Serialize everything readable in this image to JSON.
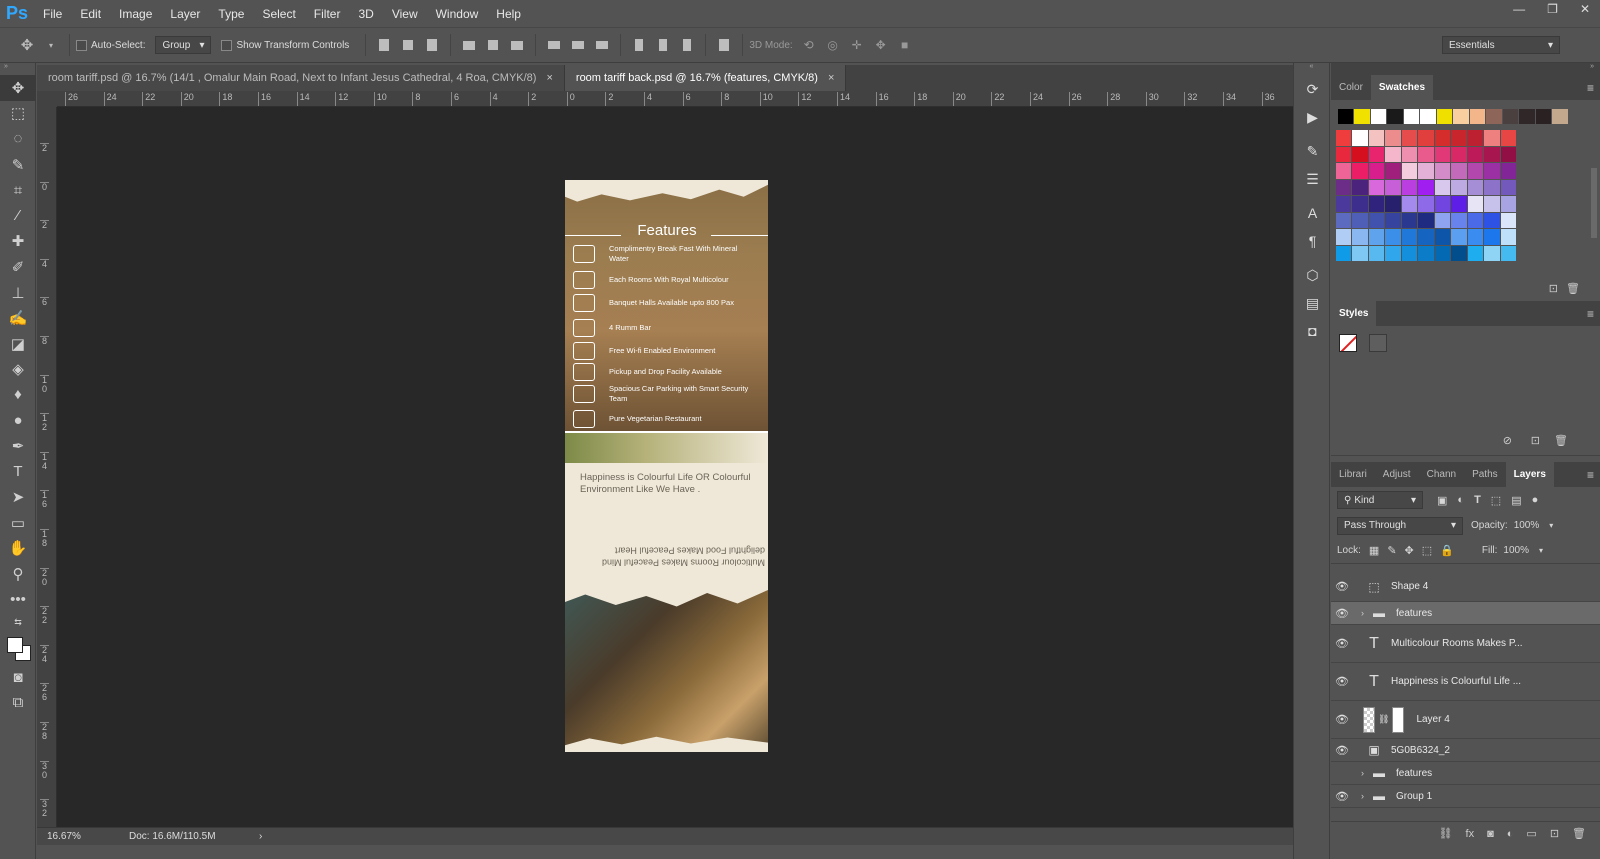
{
  "app": {
    "logo": "Ps"
  },
  "menu": [
    "File",
    "Edit",
    "Image",
    "Layer",
    "Type",
    "Select",
    "Filter",
    "3D",
    "View",
    "Window",
    "Help"
  ],
  "window_controls": {
    "minimize": "—",
    "restore": "❐",
    "close": "✕"
  },
  "options": {
    "auto_select_label": "Auto-Select:",
    "auto_select_value": "Group",
    "transform_label": "Show Transform Controls",
    "mode3d_label": "3D Mode:",
    "workspace": "Essentials"
  },
  "tabs": [
    {
      "label": "room tariff.psd @ 16.7% (14/1 , Omalur Main Road,  Next to Infant Jesus Cathedral, 4 Roa, CMYK/8)",
      "close": "×"
    },
    {
      "label": "room tariff back.psd @ 16.7% (features, CMYK/8)",
      "close": "×"
    }
  ],
  "ruler_top": [
    "26",
    "24",
    "22",
    "20",
    "18",
    "16",
    "14",
    "12",
    "10",
    "8",
    "6",
    "4",
    "2",
    "0",
    "2",
    "4",
    "6",
    "8",
    "10",
    "12",
    "14",
    "16",
    "18",
    "20",
    "22",
    "24",
    "26",
    "28",
    "30",
    "32",
    "34",
    "36"
  ],
  "ruler_left": [
    "2",
    "0",
    "2",
    "4",
    "6",
    "8",
    "10",
    "12",
    "14",
    "16",
    "18",
    "20",
    "22",
    "24",
    "26",
    "28",
    "30",
    "32"
  ],
  "document": {
    "heading": "Features",
    "features": [
      "Complimentry Break Fast With Mineral Water",
      "Each Rooms With Royal Multicolour",
      "Banquet Halls Available upto 800 Pax",
      "4 Rumm Bar",
      "Free Wi-fi Enabled Environment",
      "Pickup and Drop Facility Available",
      "Spacious Car Parking with Smart Security Team",
      "Pure Vegetarian Restaurant"
    ],
    "tagline": "Happiness is Colourful Life   OR Colourful Environment Like We Have .",
    "flipped_text": "Multicolour Rooms Makes Peaceful Mind delightful Food Makes Peaceful Heart"
  },
  "status": {
    "zoom": "16.67%",
    "doc": "Doc: 16.6M/110.5M",
    "arrow": "›"
  },
  "panels": {
    "color_tabs": [
      "Color",
      "Swatches"
    ],
    "styles_title": "Styles",
    "layers_tabs": [
      "Librari",
      "Adjust",
      "Chann",
      "Paths",
      "Layers"
    ],
    "kind": "Kind",
    "blend_mode": "Pass Through",
    "opacity_label": "Opacity:",
    "opacity_value": "100%",
    "lock_label": "Lock:",
    "fill_label": "Fill:",
    "fill_value": "100%",
    "layers": [
      {
        "name": "Shape 4",
        "type": "shape",
        "visible": true,
        "selected": false
      },
      {
        "name": "features",
        "type": "folder",
        "visible": true,
        "selected": true
      },
      {
        "name": "Multicolour Rooms Makes P...",
        "type": "text",
        "visible": true,
        "selected": false
      },
      {
        "name": "Happiness is Colourful Life ...",
        "type": "text",
        "visible": true,
        "selected": false
      },
      {
        "name": "Layer 4",
        "type": "raster",
        "visible": true,
        "selected": false
      },
      {
        "name": "5G0B6324_2",
        "type": "smart",
        "visible": true,
        "selected": false
      },
      {
        "name": "features",
        "type": "folder",
        "visible": false,
        "selected": false
      },
      {
        "name": "Group 1",
        "type": "folder",
        "visible": true,
        "selected": false
      }
    ]
  },
  "swatch_top": [
    "#000000",
    "#f1e100",
    "#ffffff",
    "#1a1a1a",
    "#ffffff",
    "#ffffff",
    "#f0e000",
    "#f9cfa0",
    "#f3b68a",
    "#8d6659",
    "#4b4040",
    "#302828",
    "#2a2222",
    "#c4a88d"
  ],
  "swatch_grid": [
    [
      "#ef3c3c",
      "#ffffff",
      "#f5c2c2",
      "#ec8c8c",
      "#e74c4c",
      "#e13e3e",
      "#d52c2c",
      "#c9252d",
      "#bd2030",
      "#ef8080",
      "#e84545"
    ],
    [
      "#e8283c",
      "#d60f1e",
      "#e8246e",
      "#f5b5ca",
      "#ef8fb0",
      "#e85b8c",
      "#e13878",
      "#d82866",
      "#bd1a5a",
      "#a81650",
      "#910f45"
    ],
    [
      "#ef6496",
      "#ec1e66",
      "#d81e8c",
      "#a01e7c",
      "#f3ccde",
      "#e3b0d8",
      "#d48cc8",
      "#c46abb",
      "#b447ad",
      "#9b30a5",
      "#822597"
    ],
    [
      "#6b2d87",
      "#4b237d",
      "#d868dc",
      "#c65fd8",
      "#bb3fe0",
      "#a11ef0",
      "#d8c8ee",
      "#beaae2",
      "#a58ed6",
      "#8d72ca",
      "#7459bc"
    ],
    [
      "#4b3a9c",
      "#3d2e8d",
      "#2f237d",
      "#26206d",
      "#a58aee",
      "#8e6ae8",
      "#7145e0",
      "#5e1ee8",
      "#e6e4f5",
      "#c6c2ec",
      "#a8a3e3"
    ],
    [
      "#5c6bc0",
      "#4f5fb8",
      "#4152ae",
      "#3644a0",
      "#2b3890",
      "#1e2b80",
      "#8fa4f0",
      "#6884ec",
      "#4a6ae8",
      "#2e52e4",
      "#dce6fb"
    ],
    [
      "#b0cdf5",
      "#8bb7f0",
      "#5ea3ec",
      "#3b8fe8",
      "#2078d8",
      "#1565c0",
      "#0d55a8",
      "#5b9ff0",
      "#3a8cf0",
      "#1c77ec",
      "#bfe0fb"
    ],
    [
      "#0f9be8",
      "#7ec8f3",
      "#58b8f0",
      "#30a6ec",
      "#138fdb",
      "#0a7cc8",
      "#0469b3",
      "#024e8c",
      "#1eaef0",
      "#8fd3f5",
      "#45baf0"
    ]
  ]
}
